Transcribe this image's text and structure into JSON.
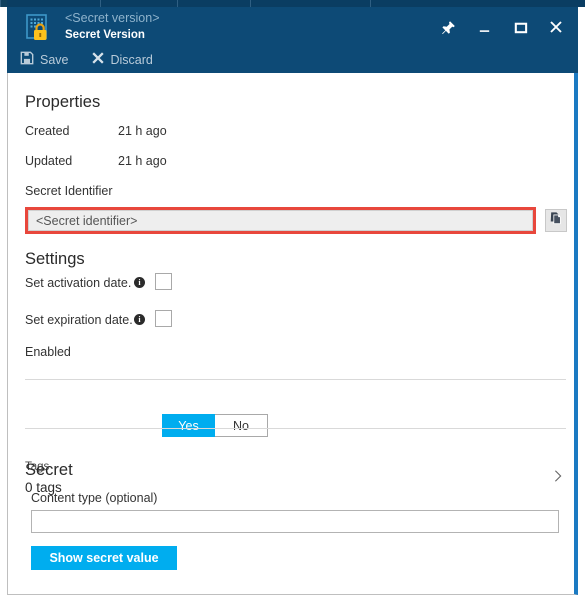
{
  "window": {
    "subtitle": "<Secret version>",
    "title": "Secret Version",
    "icon": "key-vault-secret-icon",
    "controls": [
      {
        "name": "pin-icon",
        "label": "Pin"
      },
      {
        "name": "minimize-icon",
        "label": "Minimize"
      },
      {
        "name": "maximize-icon",
        "label": "Maximize"
      },
      {
        "name": "close-icon",
        "label": "Close"
      }
    ]
  },
  "command_bar": {
    "save_label": "Save",
    "save_icon": "save-disk-icon",
    "discard_label": "Discard",
    "discard_icon": "x-cross-icon"
  },
  "properties": {
    "heading": "Properties",
    "created_label": "Created",
    "created_value": "21 h ago",
    "updated_label": "Updated",
    "updated_value": "21 h ago",
    "secret_identifier_label": "Secret Identifier",
    "secret_identifier_value": "<Secret identifier>",
    "copy_icon": "copy-clipboard-icon",
    "highlight_color": "#e8473c"
  },
  "settings": {
    "heading": "Settings",
    "activation_label": "Set activation date.",
    "activation_info_icon": "info-icon",
    "activation_checked": false,
    "expiration_label": "Set expiration date.",
    "expiration_info_icon": "info-icon",
    "expiration_checked": false,
    "enabled_label": "Enabled",
    "enabled_yes": "Yes",
    "enabled_no": "No",
    "enabled_selected": "Yes",
    "accent_color": "#00adef"
  },
  "tags": {
    "label": "Tags",
    "count_text": "0 tags",
    "chevron_icon": "chevron-right-icon"
  },
  "secret": {
    "heading": "Secret",
    "content_type_label": "Content type (optional)",
    "content_type_value": "",
    "content_type_placeholder": "",
    "show_button_label": "Show secret value"
  }
}
